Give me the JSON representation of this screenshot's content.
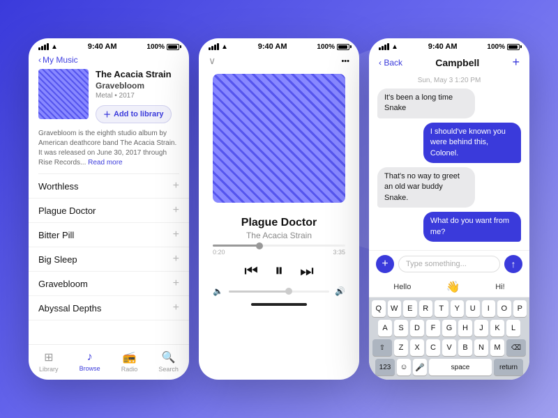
{
  "background": "#4a4aee",
  "phone1": {
    "statusBar": {
      "signal": "●●●●",
      "wifi": "wifi",
      "time": "9:40 AM",
      "battery": "100%"
    },
    "nav": {
      "back": "My Music"
    },
    "album": {
      "title": "The Acacia Strain",
      "artist": "Gravebloom",
      "meta": "Metal • 2017",
      "addLabel": "Add to library",
      "desc": "Gravebloom is the eighth studio album by American deathcore band The Acacia Strain. It was released on June 30, 2017 through Rise Records...",
      "readMore": "Read more"
    },
    "tracks": [
      {
        "name": "Worthless"
      },
      {
        "name": "Plague Doctor"
      },
      {
        "name": "Bitter Pill"
      },
      {
        "name": "Big Sleep"
      },
      {
        "name": "Gravebloom"
      },
      {
        "name": "Abyssal Depths"
      }
    ],
    "bottomNav": [
      {
        "label": "Library",
        "icon": "⊞",
        "active": false
      },
      {
        "label": "Browse",
        "icon": "♩",
        "active": true
      },
      {
        "label": "Radio",
        "icon": "((•))",
        "active": false
      },
      {
        "label": "Search",
        "icon": "⌕",
        "active": false
      }
    ]
  },
  "phone2": {
    "statusBar": {
      "time": "9:40 AM",
      "battery": "100%"
    },
    "progress": {
      "current": "0:20",
      "total": "3:35"
    },
    "track": {
      "title": "Plague Doctor",
      "artist": "The Acacia Strain"
    }
  },
  "phone3": {
    "statusBar": {
      "time": "9:40 AM",
      "battery": "100%"
    },
    "nav": {
      "back": "Back",
      "contact": "Campbell"
    },
    "dateLabel": "Sun, May 3 1:20 PM",
    "messages": [
      {
        "side": "left",
        "text": "It's been a long time Snake"
      },
      {
        "side": "right",
        "text": "I should've known you were behind this, Colonel."
      },
      {
        "side": "left",
        "text": "That's no way to greet an old war buddy Snake."
      },
      {
        "side": "right",
        "text": "What do you want from me?"
      }
    ],
    "inputPlaceholder": "Type something...",
    "quicktype": [
      "Hello",
      "👋",
      "Hi!"
    ],
    "keyboard": {
      "row1": [
        "Q",
        "W",
        "E",
        "R",
        "T",
        "Y",
        "U",
        "I",
        "O",
        "P"
      ],
      "row2": [
        "A",
        "S",
        "D",
        "F",
        "G",
        "H",
        "J",
        "K",
        "L"
      ],
      "row3": [
        "Z",
        "X",
        "C",
        "V",
        "B",
        "N",
        "M"
      ],
      "bottom": [
        "123",
        "☺",
        "🎤",
        "space",
        "return"
      ]
    }
  }
}
